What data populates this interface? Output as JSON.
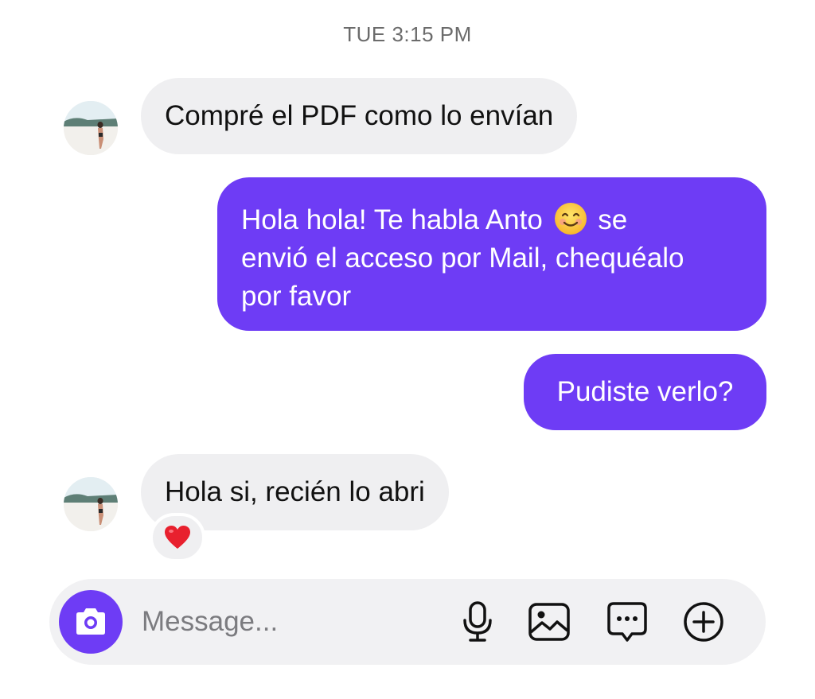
{
  "chat": {
    "timestamp": "TUE 3:15 PM",
    "messages": [
      {
        "direction": "incoming",
        "text": "Compré el PDF como lo envían"
      },
      {
        "direction": "outgoing",
        "lines": [
          "Hola hola! Te habla Anto",
          "se",
          "envió el acceso por Mail, chequéalo",
          "por favor"
        ],
        "emoji": "smiling-face-emoji"
      },
      {
        "direction": "outgoing",
        "text": "Pudiste verlo?"
      },
      {
        "direction": "incoming",
        "text": "Hola si, recién lo abri",
        "reaction": "red-heart-emoji"
      }
    ]
  },
  "composer": {
    "placeholder": "Message...",
    "icons": [
      "camera-icon",
      "microphone-icon",
      "gallery-icon",
      "sticker-chat-icon",
      "plus-circle-icon"
    ]
  },
  "colors": {
    "accent": "#6e3cf5",
    "incoming_bubble": "#efeff1",
    "timestamp": "#6b6b6b"
  }
}
